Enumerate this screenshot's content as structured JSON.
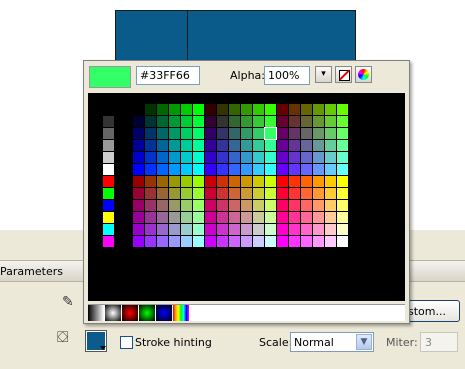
{
  "picker": {
    "current_hex": "#33FF66",
    "preview_color": "#33ff66",
    "alpha_label": "Alpha:",
    "alpha_value": "100%",
    "alpha_dropdown_glyph": "▾",
    "selected_swatch": "#33ff66",
    "left_column_colors": [
      "#000000",
      "#333333",
      "#666666",
      "#999999",
      "#cccccc",
      "#ffffff",
      "#ff0000",
      "#00ff00",
      "#0000ff",
      "#ffff00",
      "#00ffff",
      "#ff00ff"
    ],
    "icons": {
      "no_color": "no-color-icon",
      "color_wheel": "color-wheel-icon"
    }
  },
  "panel": {
    "tab_label": "Parameters",
    "custom_button": "stom...",
    "stroke_hinting_label": "Stroke hinting",
    "scale_label": "Scale:",
    "scale_value": "Normal",
    "miter_label": "Miter:",
    "miter_value": "3",
    "fill_color": "#0b5b8c",
    "stage_color": "#0a5a8a"
  }
}
